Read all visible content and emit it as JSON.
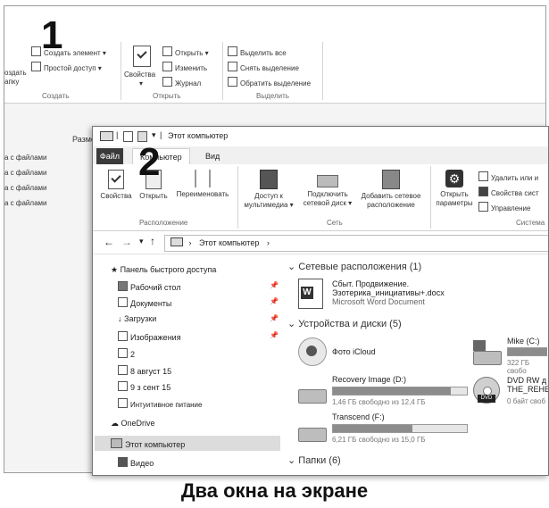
{
  "back_window": {
    "ribbon": {
      "create_element": "Создать элемент",
      "easy_access": "Простой доступ",
      "create_partial_1": "оздать",
      "create_partial_2": "апку",
      "group_create": "Создать",
      "properties": "Свойства",
      "open": "Открыть",
      "edit": "Изменить",
      "history": "Журнал",
      "group_open": "Открыть",
      "select_all": "Выделить все",
      "deselect": "Снять выделение",
      "invert": "Обратить выделение",
      "group_select": "Выделить"
    },
    "column_header": "Разме",
    "list_items": [
      "а с файлами",
      "а с файлами",
      "а с файлами",
      "а с файлами"
    ]
  },
  "overlay_numbers": {
    "one": "1",
    "two": "2"
  },
  "front_window": {
    "title": "Этот компьютер",
    "tabs": {
      "file": "Файл",
      "computer": "Компьютер",
      "view": "Вид"
    },
    "ribbon": {
      "properties": "Свойства",
      "open": "Открыть",
      "rename": "Переименовать",
      "group_location": "Расположение",
      "media_access_1": "Доступ к",
      "media_access_2": "мультимедиа",
      "map_drive_1": "Подключить",
      "map_drive_2": "сетевой диск",
      "add_location_1": "Добавить сетевое",
      "add_location_2": "расположение",
      "group_network": "Сеть",
      "open_params_1": "Открыть",
      "open_params_2": "параметры",
      "uninstall": "Удалить или и",
      "system_props": "Свойства сист",
      "manage": "Управление",
      "group_system": "Система"
    },
    "address": "Этот компьютер",
    "nav": {
      "quick_access": "Панель быстрого доступа",
      "desktop": "Рабочий стол",
      "documents": "Документы",
      "downloads": "Загрузки",
      "images": "Изображения",
      "f2": "2",
      "f_aug": "8 август 15",
      "f_sep": "9 з сент 15",
      "intuitive": "Интуитивное питание",
      "onedrive": "OneDrive",
      "this_pc": "Этот компьютер",
      "video": "Видео"
    },
    "content": {
      "network_header": "Сетевые расположения (1)",
      "doc_name_1": "Сбыт. Продвижение.",
      "doc_name_2": "Эзотерика_инициативы+.docx",
      "doc_type": "Microsoft Word Document",
      "devices_header": "Устройства и диски (5)",
      "icloud": "Фото iCloud",
      "mike_name": "Mike (C:)",
      "mike_free": "322 ГБ свобо",
      "recovery_name": "Recovery Image (D:)",
      "recovery_free": "1,46 ГБ свободно из 12,4 ГБ",
      "recovery_fill": 0.88,
      "transcend_name": "Transcend (F:)",
      "transcend_free": "6,21 ГБ свободно из 15,0 ГБ",
      "transcend_fill": 0.59,
      "dvd_name_1": "DVD RW д",
      "dvd_name_2": "THE_REHE",
      "dvd_free": "0 байт своб",
      "folders_header": "Папки (6)"
    }
  },
  "caption": "Два окна на экране"
}
